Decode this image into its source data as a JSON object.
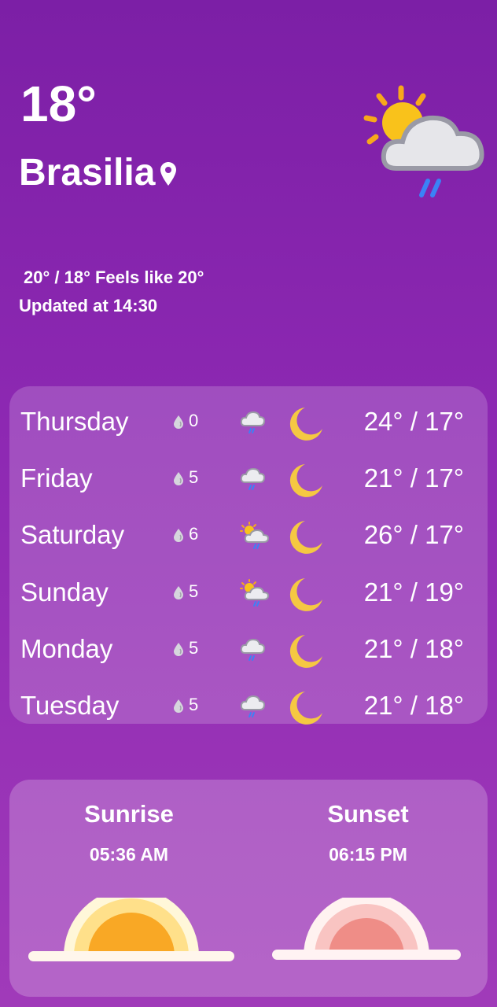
{
  "current": {
    "temperature": "18°",
    "city": "Brasilia",
    "range": " 20° / 18° Feels like 20°",
    "updated": "Updated at 14:30",
    "icon": "partly-cloudy-rain-icon"
  },
  "forecast": [
    {
      "day": "Thursday",
      "precip": "0",
      "icon": "cloud-rain-icon",
      "night_icon": "moon-icon",
      "hilo": "24° / 17°"
    },
    {
      "day": "Friday",
      "precip": "5",
      "icon": "cloud-rain-icon",
      "night_icon": "moon-icon",
      "hilo": "21° / 17°"
    },
    {
      "day": "Saturday",
      "precip": "6",
      "icon": "sun-cloud-rain-icon",
      "night_icon": "moon-icon",
      "hilo": "26° / 17°"
    },
    {
      "day": "Sunday",
      "precip": "5",
      "icon": "sun-cloud-rain-icon",
      "night_icon": "moon-icon",
      "hilo": "21° / 19°"
    },
    {
      "day": "Monday",
      "precip": "5",
      "icon": "cloud-rain-icon",
      "night_icon": "moon-icon",
      "hilo": "21° / 18°"
    },
    {
      "day": "Tuesday",
      "precip": "5",
      "icon": "cloud-rain-icon",
      "night_icon": "moon-icon",
      "hilo": "21° / 18°"
    }
  ],
  "sun": {
    "sunrise_label": "Sunrise",
    "sunrise_time": "05:36 AM",
    "sunset_label": "Sunset",
    "sunset_time": "06:15 PM"
  },
  "colors": {
    "background_top": "#7c1fa6",
    "background_bottom": "#a03ab9",
    "moon": "#f5c842",
    "sunrise_sun": "#f9a825",
    "sunset_sun": "#ef8d87"
  }
}
